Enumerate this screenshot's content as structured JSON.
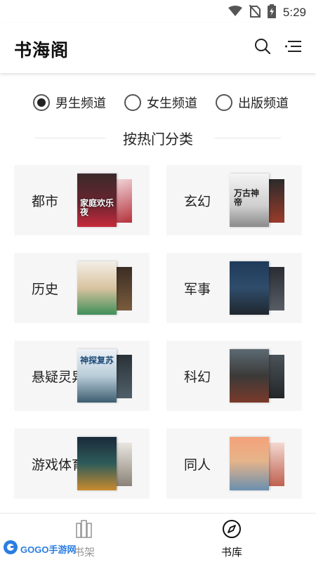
{
  "status_bar": {
    "time": "5:29",
    "icons": [
      "wifi-icon",
      "no-sim-icon",
      "battery-icon"
    ]
  },
  "header": {
    "title": "书海阁",
    "icons": [
      "search-icon",
      "menu-icon"
    ]
  },
  "channels": [
    {
      "label": "男生频道",
      "selected": true
    },
    {
      "label": "女生频道",
      "selected": false
    },
    {
      "label": "出版频道",
      "selected": false
    }
  ],
  "section": {
    "title": "按热门分类"
  },
  "categories": [
    {
      "label": "都市",
      "cover_text": "家庭欢乐夜"
    },
    {
      "label": "玄幻",
      "cover_text": "万古神帝"
    },
    {
      "label": "历史",
      "cover_text": ""
    },
    {
      "label": "军事",
      "cover_text": ""
    },
    {
      "label": "悬疑灵异",
      "cover_text": "神探复苏"
    },
    {
      "label": "科幻",
      "cover_text": ""
    },
    {
      "label": "游戏体育",
      "cover_text": ""
    },
    {
      "label": "同人",
      "cover_text": ""
    }
  ],
  "bottom_nav": [
    {
      "label": "书架",
      "active": false
    },
    {
      "label": "书库",
      "active": true
    }
  ],
  "watermark": {
    "text": "GOGO手游网"
  },
  "colors": {
    "active": "#111111",
    "inactive": "#999999",
    "card_bg": "#f6f6f6"
  }
}
